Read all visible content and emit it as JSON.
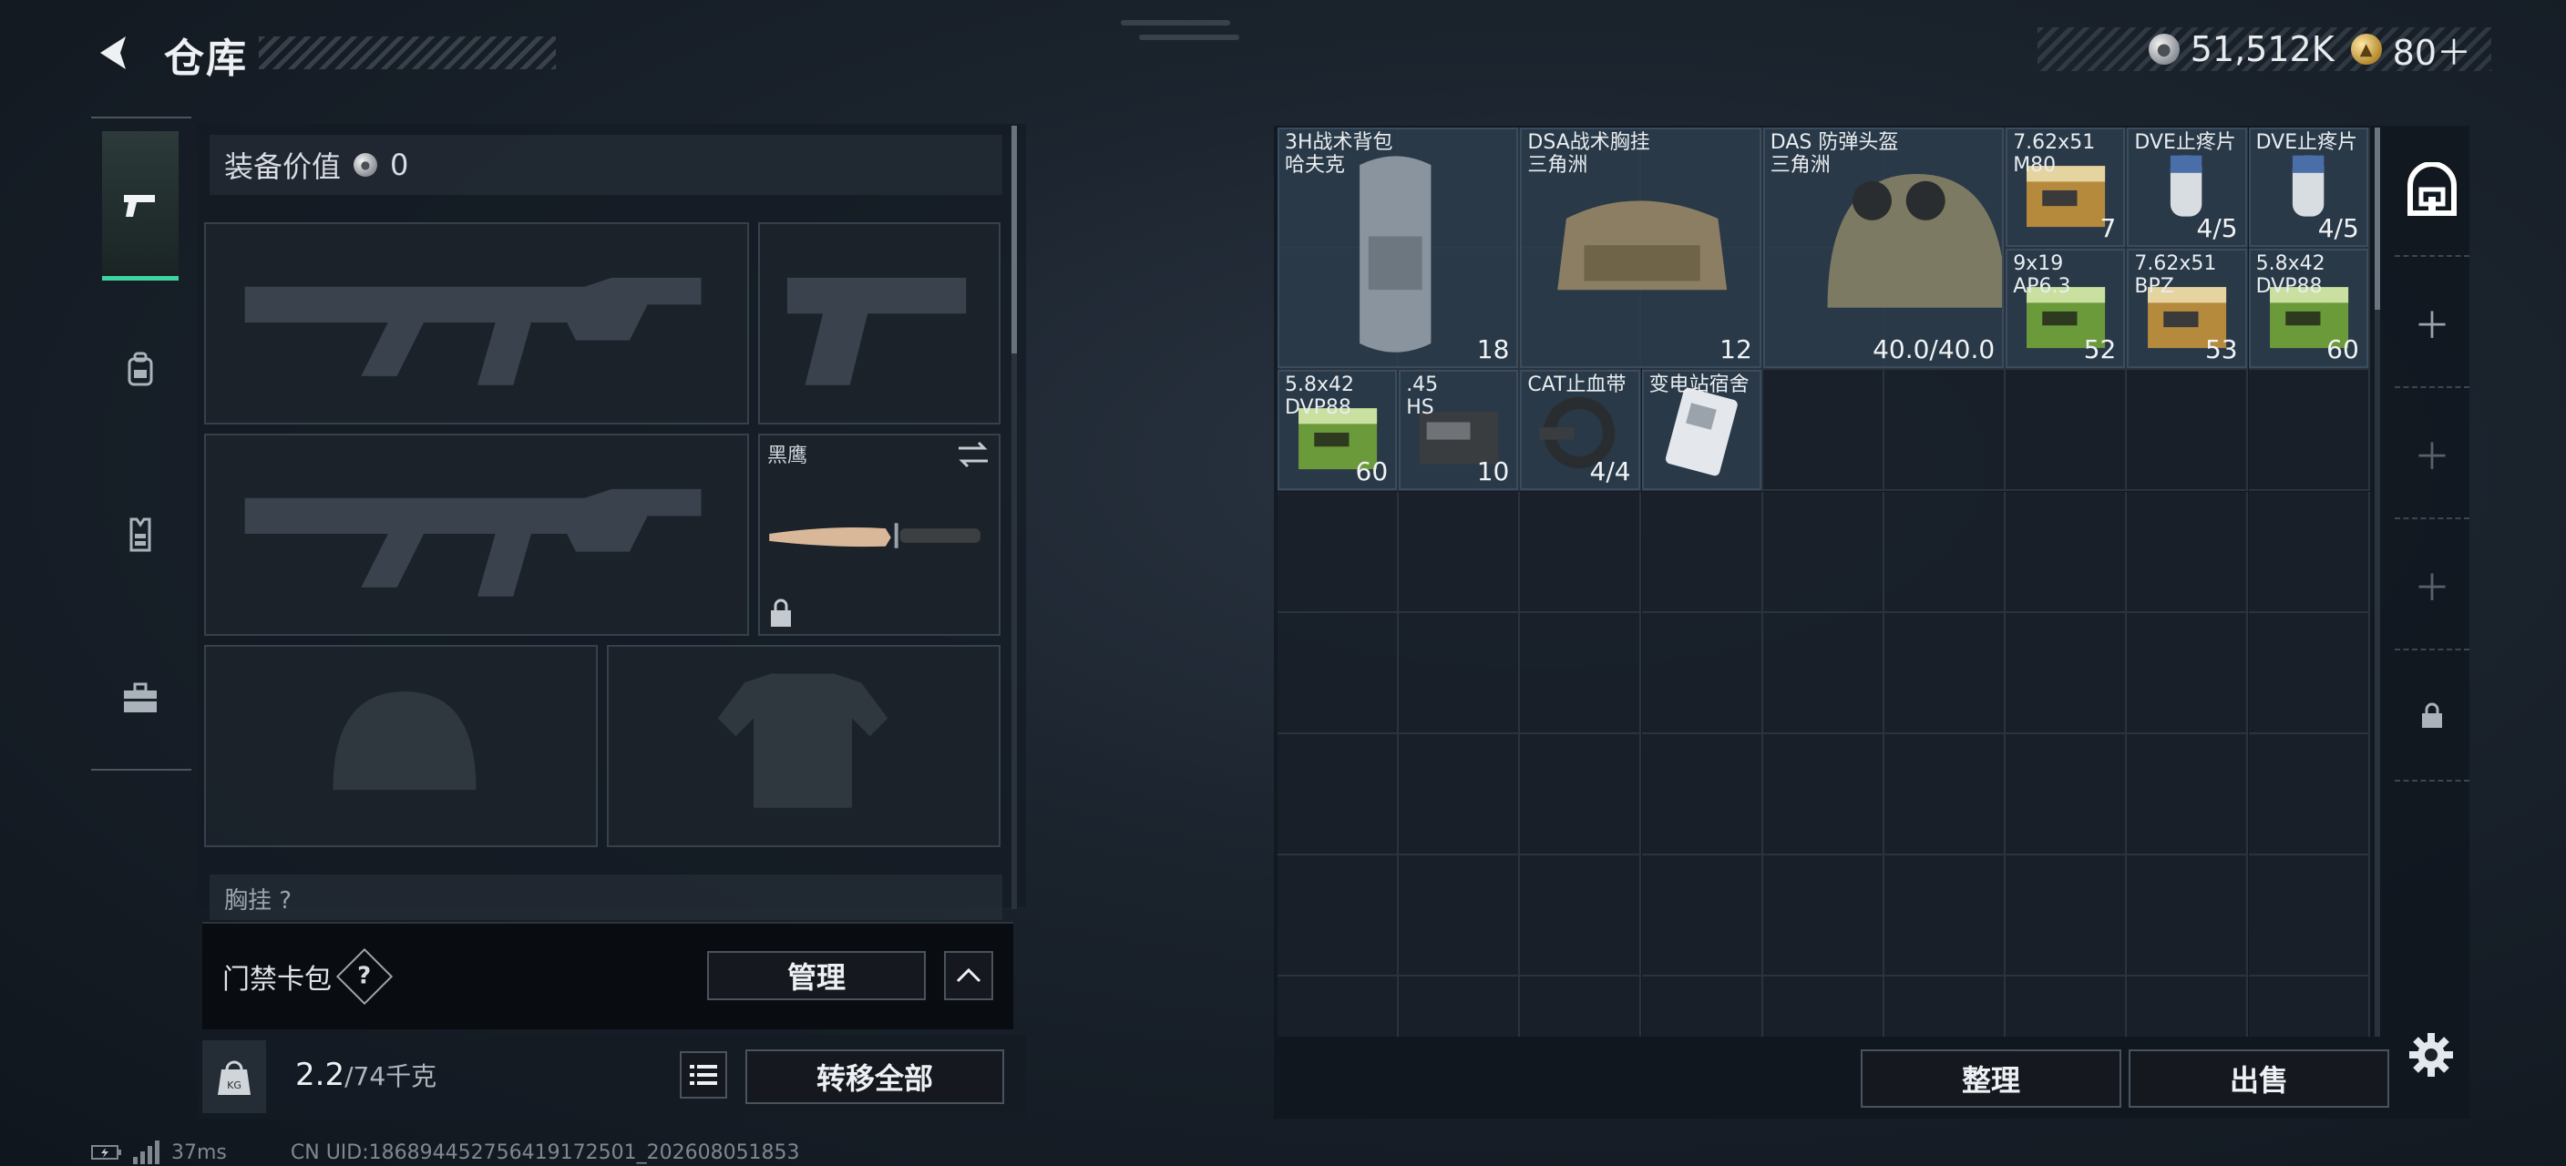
{
  "header": {
    "title": "仓库",
    "currencies": [
      {
        "icon": "silver-coin-icon",
        "value": "51,512K"
      },
      {
        "icon": "gold-coin-icon",
        "value": "80＋"
      }
    ]
  },
  "nav": {
    "items": [
      {
        "name": "weapons",
        "icon": "pistol-icon",
        "active": true
      },
      {
        "name": "backpack",
        "icon": "backpack-icon",
        "active": false
      },
      {
        "name": "vest",
        "icon": "vest-icon",
        "active": false
      },
      {
        "name": "kit",
        "icon": "toolbox-icon",
        "active": false
      }
    ]
  },
  "equipment": {
    "value_label": "装备价值",
    "value": "0",
    "melee_label": "黑鹰",
    "chest_row_label": "胸挂 ?"
  },
  "keycard": {
    "label": "门禁卡包",
    "help": "?",
    "manage_label": "管理",
    "collapse_glyph": "︿"
  },
  "weight": {
    "current": "2.2",
    "capacity": "/74千克",
    "transfer_label": "转移全部"
  },
  "status_bar": {
    "ping": "37ms",
    "uid": "CN UID:186894452756419172501_202608051853"
  },
  "inventory": {
    "items": [
      {
        "name": "3H战术背包\n哈夫克",
        "qty": "18",
        "qty_icon": "capacity",
        "kind": "backpack"
      },
      {
        "name": "DSA战术胸挂\n三角洲",
        "qty": "12",
        "qty_icon": "vest",
        "kind": "vest"
      },
      {
        "name": "DAS 防弹头盔\n三角洲",
        "qty": "40.0/40.0",
        "kind": "helmet"
      },
      {
        "name": "7.62x51\nM80",
        "qty": "7",
        "kind": "ammo-box"
      },
      {
        "name": "DVE止疼片",
        "qty": "4/5",
        "kind": "pill"
      },
      {
        "name": "DVE止疼片",
        "qty": "4/5",
        "kind": "pill"
      },
      {
        "name": "9x19\nAP6.3",
        "qty": "52",
        "kind": "ammo-box-green"
      },
      {
        "name": "7.62x51\nBPZ",
        "qty": "53",
        "kind": "ammo-box"
      },
      {
        "name": "5.8x42\nDVP88",
        "qty": "60",
        "kind": "ammo-box-green"
      },
      {
        "name": "5.8x42\nDVP88",
        "qty": "60",
        "kind": "ammo-box-green"
      },
      {
        "name": ".45\nHS",
        "qty": "10",
        "kind": "ammo-box-dark"
      },
      {
        "name": "CAT止血带",
        "qty": "4/4",
        "kind": "tourniquet"
      },
      {
        "name": "变电站宿舍",
        "qty": "",
        "kind": "keycard"
      }
    ],
    "sort_label": "整理",
    "sell_label": "出售"
  },
  "colors": {
    "accent": "#3fd3a0",
    "item_bg": "#2d3e4e",
    "panel_bg": "#141b23"
  }
}
